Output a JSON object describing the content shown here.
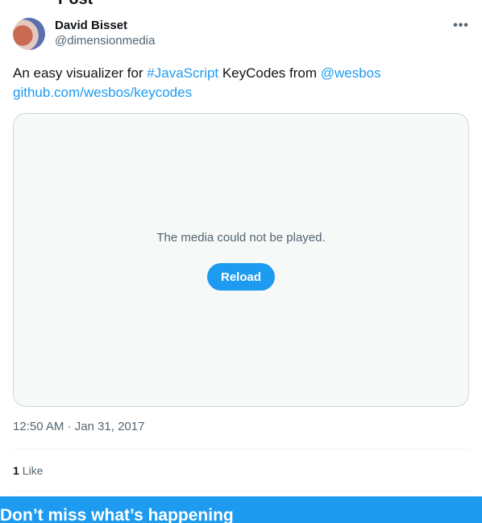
{
  "header": {
    "partial_title": "Post"
  },
  "tweet": {
    "author_name": "David Bisset",
    "author_handle": "@dimensionmedia",
    "text_prefix": "An easy visualizer for ",
    "hashtag": "#JavaScript",
    "text_middle": " KeyCodes from ",
    "mention": "@wesbos",
    "link": "github.com/wesbos/keycodes",
    "media_error": "The media could not be played.",
    "reload_label": "Reload",
    "timestamp": "12:50 AM · Jan 31, 2017",
    "likes_count": "1",
    "likes_label": "Like"
  },
  "banner": {
    "title": "Don’t miss what’s happening"
  },
  "colors": {
    "accent": "#1d9bf0",
    "text": "#0f1419",
    "muted": "#536471",
    "border": "#cfd9de"
  },
  "icons": {
    "more": "more-horizontal-icon"
  }
}
